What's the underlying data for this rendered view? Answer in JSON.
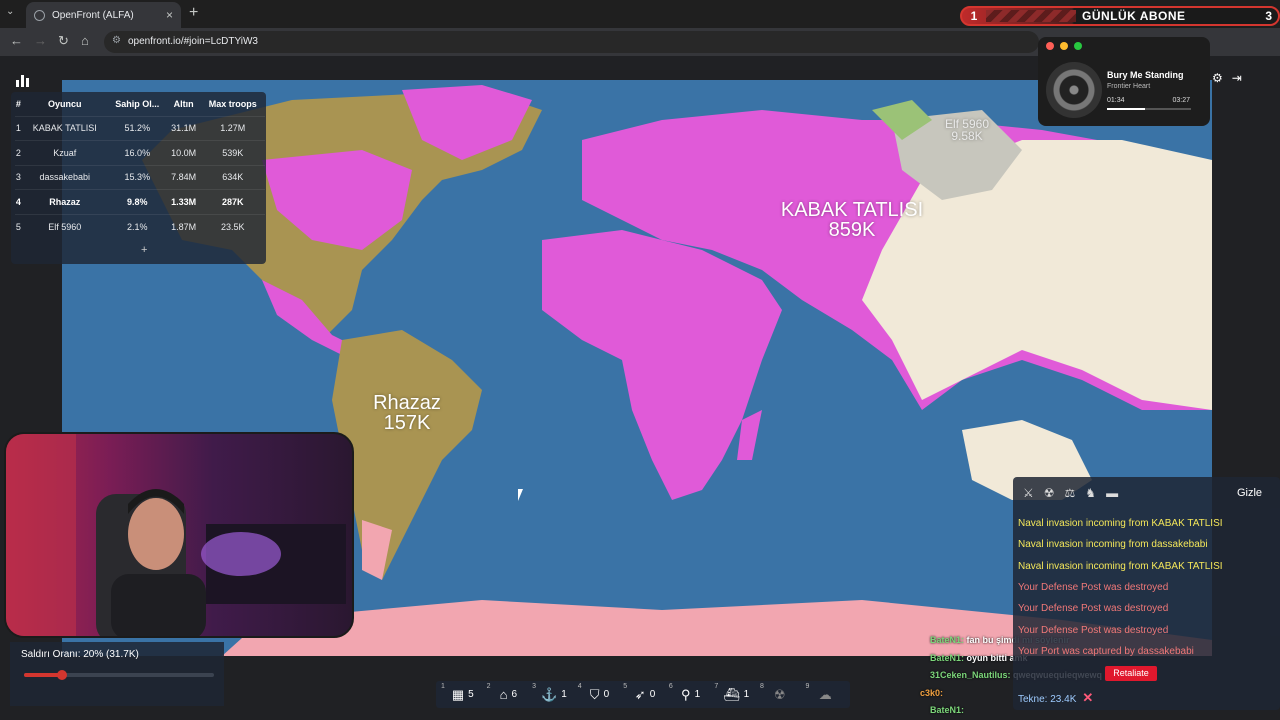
{
  "browser": {
    "tab_title": "OpenFront (ALFA)",
    "url": "openfront.io/#join=LcDTYiW3"
  },
  "banner": {
    "left": "1",
    "label": "GÜNLÜK ABONE",
    "right": "3"
  },
  "music": {
    "title": "Bury Me Standing",
    "artist": "Frontier Heart",
    "elapsed": "01:34",
    "total": "03:27",
    "progress": 0.45
  },
  "leaderboard": {
    "headers": [
      "#",
      "Oyuncu",
      "Sahip Ol...",
      "Altın",
      "Max troops"
    ],
    "rows": [
      [
        "1",
        "KABAK TATLISI",
        "51.2%",
        "31.1M",
        "1.27M"
      ],
      [
        "2",
        "Kzuaf",
        "16.0%",
        "10.0M",
        "539K"
      ],
      [
        "3",
        "dassakebabi",
        "15.3%",
        "7.84M",
        "634K"
      ],
      [
        "4",
        "Rhazaz",
        "9.8%",
        "1.33M",
        "287K"
      ],
      [
        "5",
        "Elf 5960",
        "2.1%",
        "1.87M",
        "23.5K"
      ]
    ],
    "expand": "+"
  },
  "map_labels": {
    "kabak_name": "KABAK TATLISI",
    "kabak_troops": "859K",
    "rhazaz_name": "Rhazaz",
    "rhazaz_troops": "157K",
    "elf_name": "Elf 5960",
    "elf_troops": "9.58K"
  },
  "attack": {
    "label": "Saldırı Oranı: 20% (31.7K)",
    "ratio": 0.2
  },
  "buildbar": [
    {
      "key": "1",
      "icon": "city-icon",
      "glyph": "▦",
      "count": "5"
    },
    {
      "key": "2",
      "icon": "factory-icon",
      "glyph": "⌂",
      "count": "6"
    },
    {
      "key": "3",
      "icon": "port-anchor-icon",
      "glyph": "⚓",
      "count": "1"
    },
    {
      "key": "4",
      "icon": "defense-shield-icon",
      "glyph": "⛉",
      "count": "0"
    },
    {
      "key": "5",
      "icon": "missile-silo-icon",
      "glyph": "➶",
      "count": "0"
    },
    {
      "key": "6",
      "icon": "sam-launcher-icon",
      "glyph": "⚲",
      "count": "1"
    },
    {
      "key": "7",
      "icon": "warship-icon",
      "glyph": "⛴",
      "count": "1"
    },
    {
      "key": "8",
      "icon": "atom-bomb-icon",
      "glyph": "☢",
      "count": ""
    },
    {
      "key": "9",
      "icon": "hydrogen-bomb-icon",
      "glyph": "☁",
      "count": ""
    }
  ],
  "events": {
    "hide": "Gizle",
    "items": [
      {
        "text": "Naval invasion incoming from KABAK TATLISI",
        "kind": "yel"
      },
      {
        "text": "Naval invasion incoming from dassakebabi",
        "kind": "yel"
      },
      {
        "text": "Naval invasion incoming from KABAK TATLISI",
        "kind": "yel"
      },
      {
        "text": "Your Defense Post was destroyed",
        "kind": "red"
      },
      {
        "text": "Your Defense Post was destroyed",
        "kind": "red"
      },
      {
        "text": "Your Defense Post was destroyed",
        "kind": "red"
      },
      {
        "text": "Your Port was captured by dassakebabi",
        "kind": "red"
      }
    ],
    "boat": "Tekne: 23.4K",
    "retaliate": "Retaliate"
  },
  "chat": [
    {
      "user": "BateN1:",
      "msg": "fan bu şimdi mi söylenir"
    },
    {
      "user": "BateN1:",
      "msg": "oyun bitti amk"
    },
    {
      "user": "31Ceken_Nautilus:",
      "msg": "qweqwuequieqwewq"
    },
    {
      "user": "c3k0:",
      "msg": ""
    },
    {
      "user": "BateN1:",
      "msg": ""
    }
  ],
  "colors": {
    "ocean": "#3a73a6",
    "kabak": "#e05ad8",
    "rhazaz": "#a99452",
    "dassakebabi": "#f2a6b0",
    "kzuaf": "#f1e9d8",
    "elf": "#c7c6bd"
  }
}
